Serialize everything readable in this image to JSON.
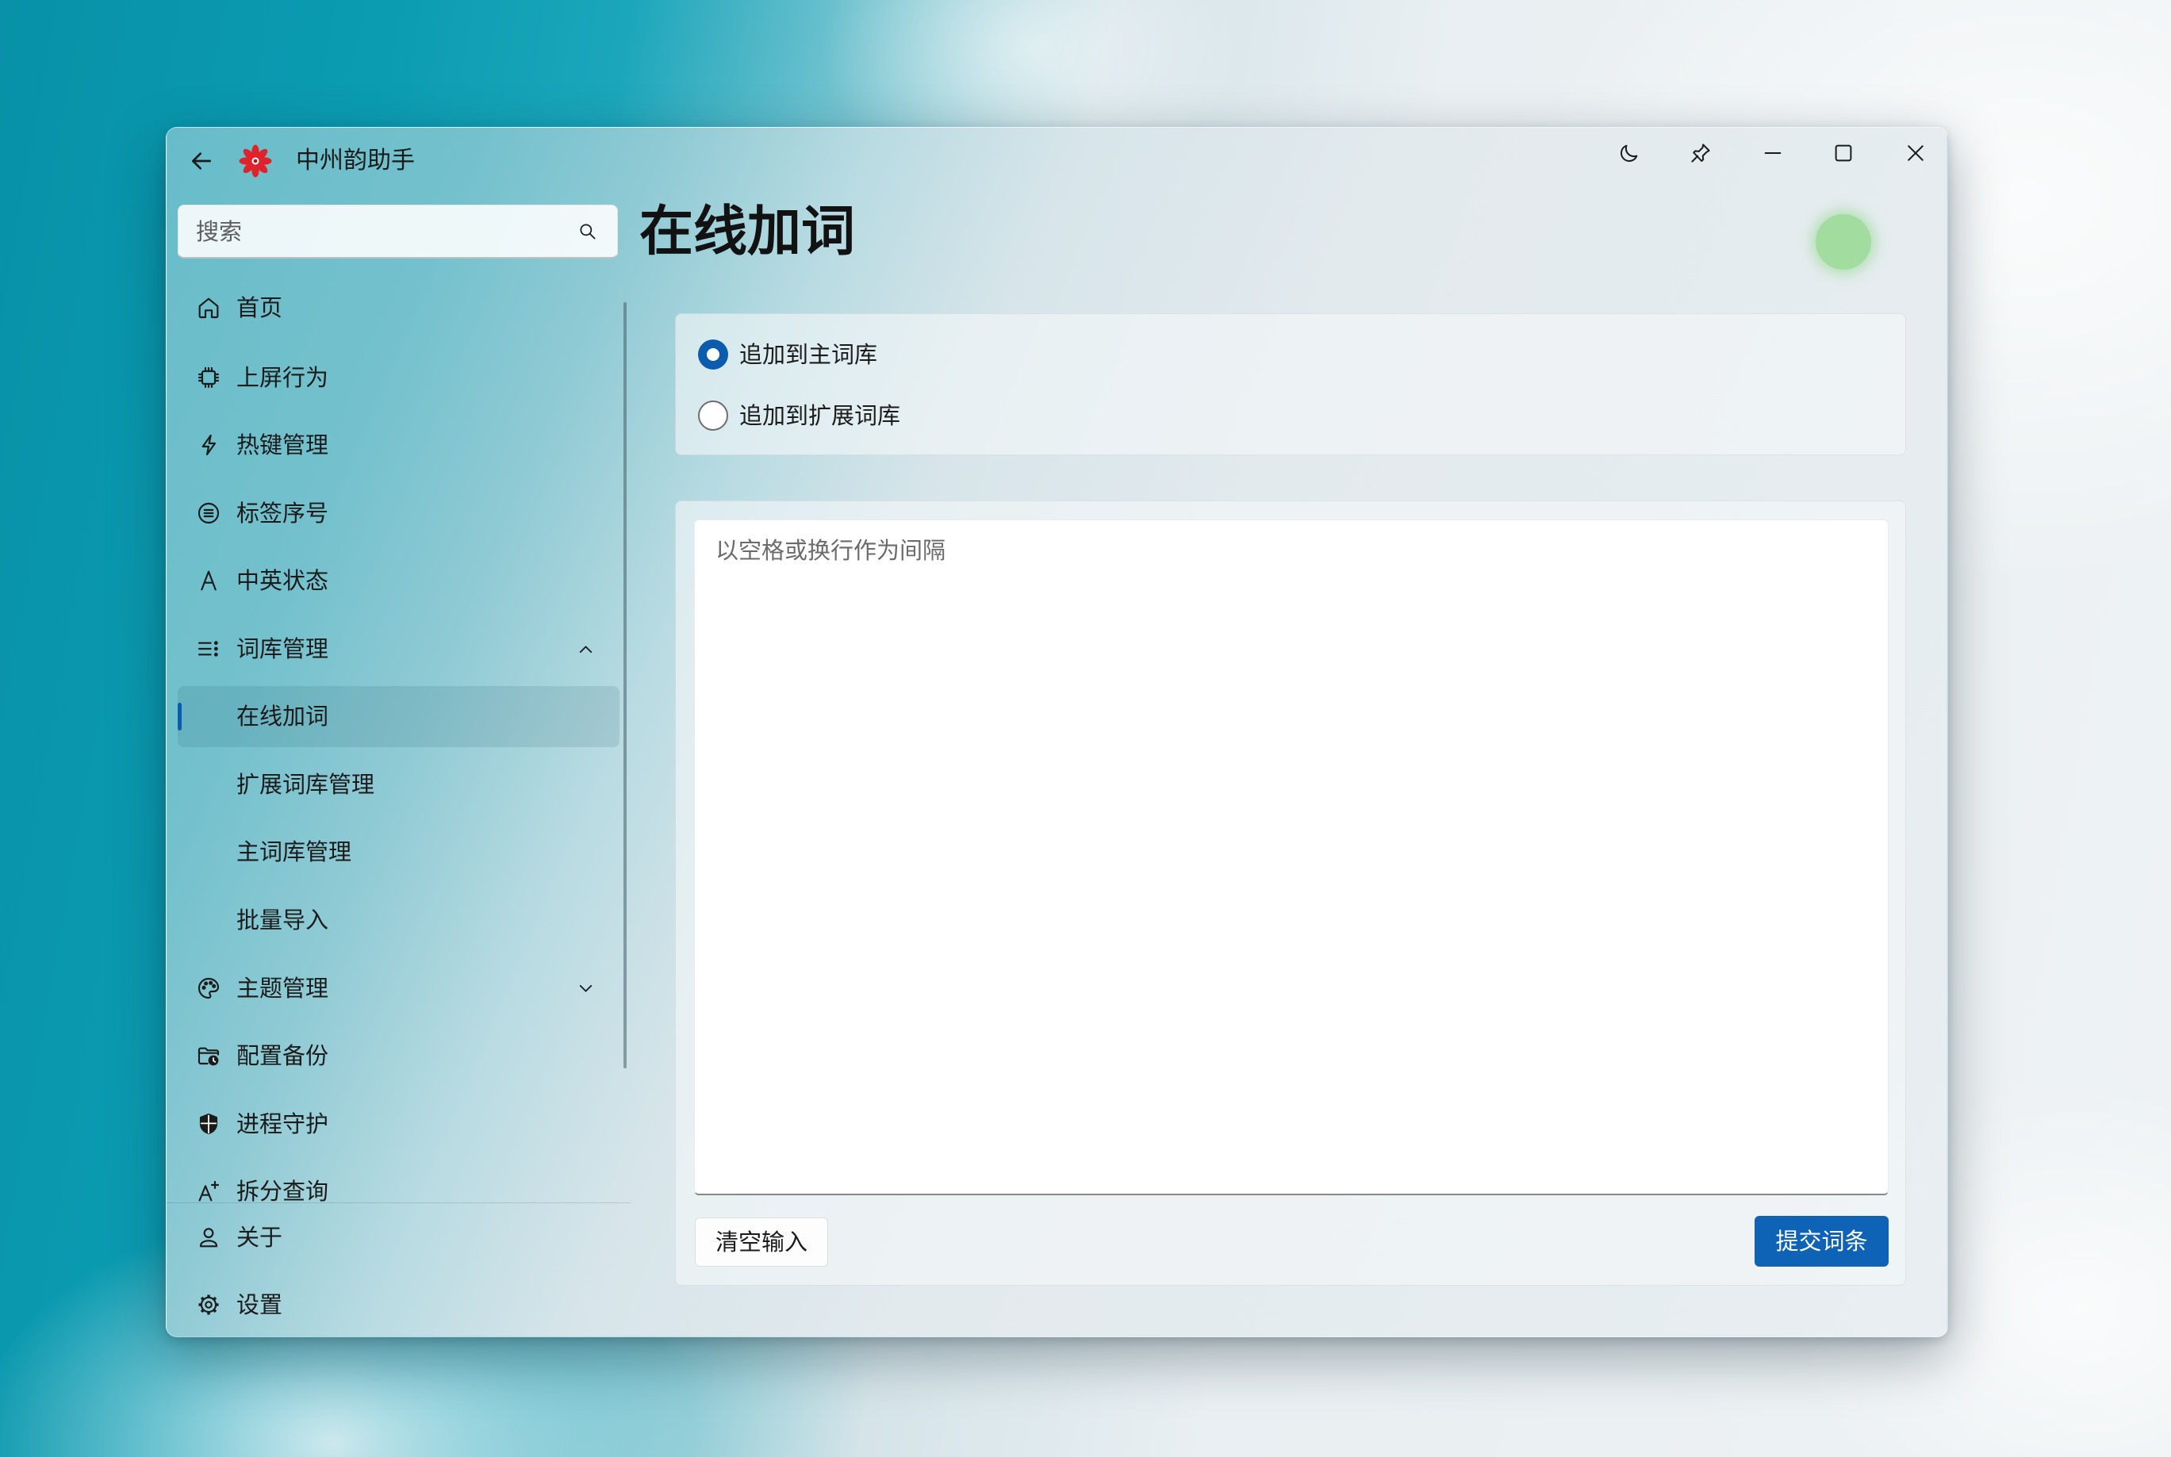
{
  "window": {
    "app_title": "中州韵助手"
  },
  "titlebar": {
    "icons": [
      "back-arrow-icon",
      "logo-icon",
      "moon-icon",
      "pin-icon",
      "minimize-icon",
      "maximize-icon",
      "close-icon"
    ]
  },
  "search": {
    "placeholder": "搜索",
    "value": "",
    "icon": "search-icon"
  },
  "page": {
    "title": "在线加词",
    "status_dot_color": "#a3dc9f"
  },
  "nav": {
    "items": [
      {
        "label": "首页",
        "icon": "home-icon"
      },
      {
        "label": "上屏行为",
        "icon": "chip-icon"
      },
      {
        "label": "热键管理",
        "icon": "lightning-icon"
      },
      {
        "label": "标签序号",
        "icon": "list-circle-icon"
      },
      {
        "label": "中英状态",
        "icon": "letter-a-icon"
      },
      {
        "label": "词库管理",
        "icon": "dictionary-list-icon",
        "expanded": true,
        "children": [
          {
            "label": "在线加词",
            "selected": true
          },
          {
            "label": "扩展词库管理",
            "selected": false
          },
          {
            "label": "主词库管理",
            "selected": false
          },
          {
            "label": "批量导入",
            "selected": false
          }
        ]
      },
      {
        "label": "主题管理",
        "icon": "palette-icon",
        "expanded": false
      },
      {
        "label": "配置备份",
        "icon": "folder-backup-icon"
      },
      {
        "label": "进程守护",
        "icon": "shield-icon"
      },
      {
        "label": "拆分查询",
        "icon": "text-split-icon"
      }
    ],
    "footer": [
      {
        "label": "关于",
        "icon": "person-icon"
      },
      {
        "label": "设置",
        "icon": "gear-icon"
      }
    ]
  },
  "target": {
    "options": [
      {
        "label": "追加到主词库",
        "checked": true
      },
      {
        "label": "追加到扩展词库",
        "checked": false
      }
    ]
  },
  "editor": {
    "placeholder": "以空格或换行作为间隔",
    "value": ""
  },
  "actions": {
    "clear_label": "清空输入",
    "submit_label": "提交词条"
  },
  "colors": {
    "accent": "#0f63b6",
    "selection_indicator": "#0b5cad",
    "status_dot": "#a3dc9f"
  }
}
